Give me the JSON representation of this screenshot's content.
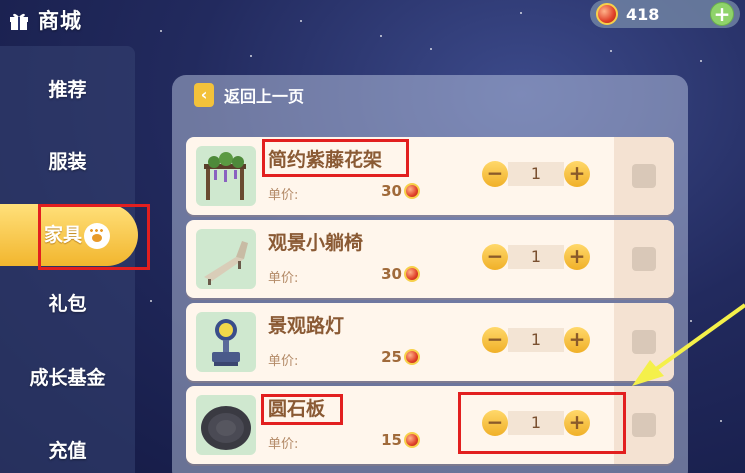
{
  "header": {
    "title": "商城",
    "icon": "gift-icon"
  },
  "currency": {
    "value": "418",
    "icon": "coin-icon",
    "add_label": "+"
  },
  "sidebar": {
    "items": [
      {
        "label": "推荐"
      },
      {
        "label": "服装"
      },
      {
        "label": "家具",
        "active": true
      },
      {
        "label": "礼包"
      },
      {
        "label": "成长基金"
      },
      {
        "label": "充值"
      }
    ]
  },
  "panel": {
    "back_label": "返回上一页",
    "back_icon_glyph": "‹",
    "price_label": "单价:",
    "items": [
      {
        "name": "简约紫藤花架",
        "price": "30",
        "qty": "1"
      },
      {
        "name": "观景小躺椅",
        "price": "30",
        "qty": "1"
      },
      {
        "name": "景观路灯",
        "price": "25",
        "qty": "1"
      },
      {
        "name": "圆石板",
        "price": "15",
        "qty": "1"
      }
    ],
    "minus_label": "−",
    "plus_label": "+"
  },
  "colors": {
    "accent": "#f2b62e",
    "highlight": "#e21f1f",
    "arrow": "#f4f04a"
  }
}
